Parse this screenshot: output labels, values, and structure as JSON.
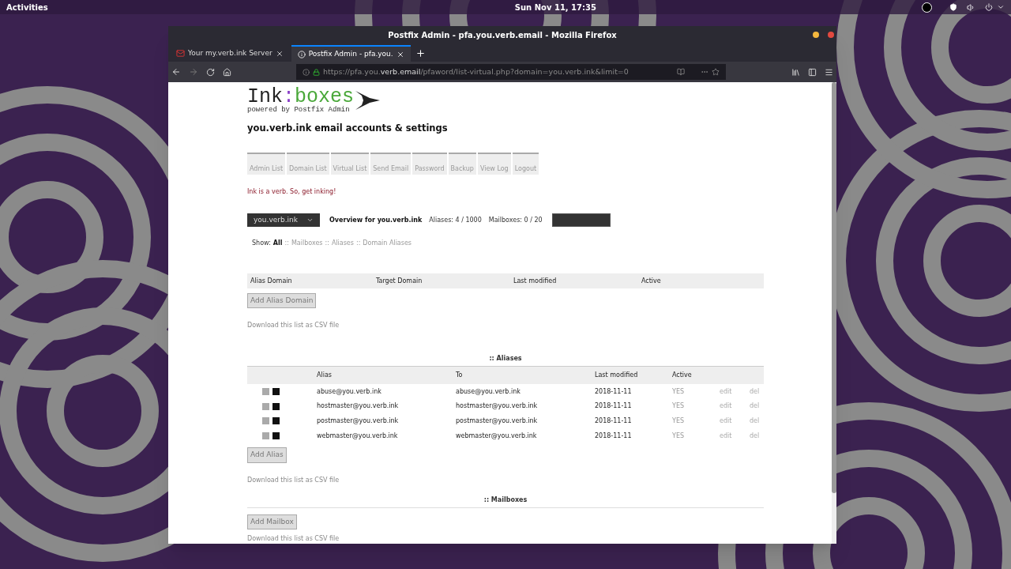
{
  "top_bar": {
    "activities": "Activities",
    "clock": "Sun Nov 11, 17:35"
  },
  "window": {
    "title": "Postfix Admin - pfa.you.verb.email - Mozilla Firefox"
  },
  "tabs": [
    {
      "label": "Your my.verb.ink Server",
      "selected": false
    },
    {
      "label": "Postfix Admin - pfa.you.",
      "selected": true
    }
  ],
  "url": "https://pfa.you.**verb.email**/pfaword/list-virtual.php?domain=you.verb.ink&limit=0",
  "logo": {
    "word1": "Ink",
    "colon": ":",
    "word2": "boxes",
    "tagline": "powered by Postfix Admin"
  },
  "heading": "you.verb.ink email accounts & settings",
  "menu": [
    "Admin List",
    "Domain List",
    "Virtual List",
    "Send Email",
    "Password",
    "Backup",
    "View Log",
    "Logout"
  ],
  "motto": "Ink is a verb. So, get inking!",
  "domain_select": {
    "value": "you.verb.ink"
  },
  "overview": {
    "label": "Overview for you.verb.ink",
    "aliases": "Aliases: 4 / 1000",
    "mailboxes": "Mailboxes: 0 / 20"
  },
  "show_filter": {
    "label": "Show:",
    "separator": "::",
    "options": [
      {
        "label": "All",
        "selected": true
      },
      {
        "label": "Mailboxes",
        "selected": false
      },
      {
        "label": "Aliases",
        "selected": false
      },
      {
        "label": "Domain Aliases",
        "selected": false
      }
    ]
  },
  "alias_domains": {
    "columns": [
      "Alias Domain",
      "Target Domain",
      "Last modified",
      "Active"
    ],
    "button": "Add Alias Domain",
    "download": "Download this list as CSV file"
  },
  "aliases": {
    "title": ":: Aliases",
    "columns": [
      "Alias",
      "To",
      "Last modified",
      "Active"
    ],
    "rows": [
      {
        "alias": "abuse@you.verb.ink",
        "to": "abuse@you.verb.ink",
        "modified": "2018-11-11",
        "active": "YES",
        "edit": "edit",
        "del": "del"
      },
      {
        "alias": "hostmaster@you.verb.ink",
        "to": "hostmaster@you.verb.ink",
        "modified": "2018-11-11",
        "active": "YES",
        "edit": "edit",
        "del": "del"
      },
      {
        "alias": "postmaster@you.verb.ink",
        "to": "postmaster@you.verb.ink",
        "modified": "2018-11-11",
        "active": "YES",
        "edit": "edit",
        "del": "del"
      },
      {
        "alias": "webmaster@you.verb.ink",
        "to": "webmaster@you.verb.ink",
        "modified": "2018-11-11",
        "active": "YES",
        "edit": "edit",
        "del": "del"
      }
    ],
    "button": "Add Alias",
    "download": "Download this list as CSV file"
  },
  "mailboxes": {
    "title": ":: Mailboxes",
    "button": "Add Mailbox",
    "download": "Download this list as CSV file"
  }
}
